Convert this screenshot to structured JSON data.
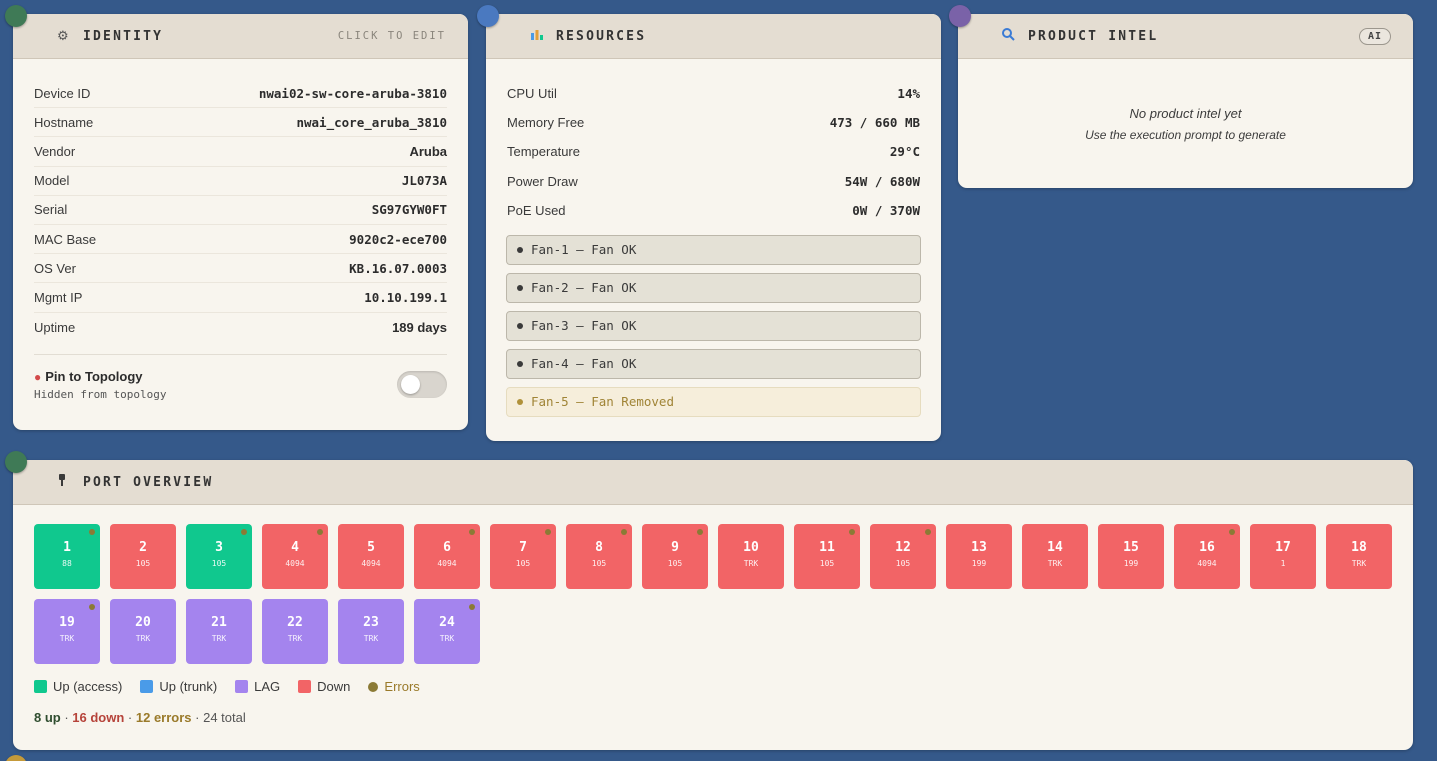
{
  "colors": {
    "background": "#35598a",
    "card": "#f8f5ee",
    "header": "#e4ddd2",
    "port_up": "#10c88e",
    "port_trunk": "#4a9be8",
    "port_lag": "#a484ee",
    "port_down": "#f26466",
    "error": "#8b7a35"
  },
  "identity": {
    "icon": "network-icon",
    "title": "IDENTITY",
    "edit_label": "CLICK TO EDIT",
    "rows": [
      {
        "label": "Device ID",
        "value": "nwai02-sw-core-aruba-3810"
      },
      {
        "label": "Hostname",
        "value": "nwai_core_aruba_3810"
      },
      {
        "label": "Vendor",
        "value": "Aruba"
      },
      {
        "label": "Model",
        "value": "JL073A"
      },
      {
        "label": "Serial",
        "value": "SG97GYW0FT"
      },
      {
        "label": "MAC Base",
        "value": "9020c2-ece700"
      },
      {
        "label": "OS Ver",
        "value": "KB.16.07.0003"
      },
      {
        "label": "Mgmt IP",
        "value": "10.10.199.1"
      },
      {
        "label": "Uptime",
        "value": "189 days"
      }
    ],
    "pin_title": "Pin to Topology",
    "pin_subtitle": "Hidden from topology",
    "pin_toggle_on": false
  },
  "resources": {
    "icon": "bar-chart-icon",
    "title": "RESOURCES",
    "rows": [
      {
        "label": "CPU Util",
        "value": "14%"
      },
      {
        "label": "Memory Free",
        "value": "473 / 660 MB"
      },
      {
        "label": "Temperature",
        "value": "29°C"
      },
      {
        "label": "Power Draw",
        "value": "54W / 680W"
      },
      {
        "label": "PoE Used",
        "value": "0W / 370W"
      }
    ],
    "fans": [
      {
        "label": "Fan-1 — Fan OK",
        "status": "ok"
      },
      {
        "label": "Fan-2 — Fan OK",
        "status": "ok"
      },
      {
        "label": "Fan-3 — Fan OK",
        "status": "ok"
      },
      {
        "label": "Fan-4 — Fan OK",
        "status": "ok"
      },
      {
        "label": "Fan-5 — Fan Removed",
        "status": "removed"
      }
    ]
  },
  "product_intel": {
    "icon": "magnifier-icon",
    "title": "PRODUCT INTEL",
    "badge": "AI",
    "empty_title": "No product intel yet",
    "empty_subtitle": "Use the execution prompt to generate"
  },
  "ports_panel": {
    "icon": "plug-icon",
    "title": "PORT OVERVIEW",
    "ports": [
      {
        "num": "1",
        "vlan": "88",
        "state": "up",
        "error": true
      },
      {
        "num": "2",
        "vlan": "105",
        "state": "down",
        "error": false
      },
      {
        "num": "3",
        "vlan": "105",
        "state": "up",
        "error": true
      },
      {
        "num": "4",
        "vlan": "4094",
        "state": "down",
        "error": true
      },
      {
        "num": "5",
        "vlan": "4094",
        "state": "down",
        "error": false
      },
      {
        "num": "6",
        "vlan": "4094",
        "state": "down",
        "error": true
      },
      {
        "num": "7",
        "vlan": "105",
        "state": "down",
        "error": true
      },
      {
        "num": "8",
        "vlan": "105",
        "state": "down",
        "error": true
      },
      {
        "num": "9",
        "vlan": "105",
        "state": "down",
        "error": true
      },
      {
        "num": "10",
        "vlan": "TRK",
        "state": "down",
        "error": false
      },
      {
        "num": "11",
        "vlan": "105",
        "state": "down",
        "error": true
      },
      {
        "num": "12",
        "vlan": "105",
        "state": "down",
        "error": true
      },
      {
        "num": "13",
        "vlan": "199",
        "state": "down",
        "error": false
      },
      {
        "num": "14",
        "vlan": "TRK",
        "state": "down",
        "error": false
      },
      {
        "num": "15",
        "vlan": "199",
        "state": "down",
        "error": false
      },
      {
        "num": "16",
        "vlan": "4094",
        "state": "down",
        "error": true
      },
      {
        "num": "17",
        "vlan": "1",
        "state": "down",
        "error": false
      },
      {
        "num": "18",
        "vlan": "TRK",
        "state": "down",
        "error": false
      },
      {
        "num": "19",
        "vlan": "TRK",
        "state": "lag",
        "error": true
      },
      {
        "num": "20",
        "vlan": "TRK",
        "state": "lag",
        "error": false
      },
      {
        "num": "21",
        "vlan": "TRK",
        "state": "lag",
        "error": false
      },
      {
        "num": "22",
        "vlan": "TRK",
        "state": "lag",
        "error": false
      },
      {
        "num": "23",
        "vlan": "TRK",
        "state": "lag",
        "error": false
      },
      {
        "num": "24",
        "vlan": "TRK",
        "state": "lag",
        "error": true
      }
    ],
    "legend": [
      {
        "label": "Up (access)",
        "color": "#10c88e",
        "shape": "square"
      },
      {
        "label": "Up (trunk)",
        "color": "#4a9be8",
        "shape": "square"
      },
      {
        "label": "LAG",
        "color": "#a484ee",
        "shape": "square"
      },
      {
        "label": "Down",
        "color": "#f26466",
        "shape": "square"
      },
      {
        "label": "Errors",
        "color": "#8b7a35",
        "shape": "dot"
      }
    ],
    "summary": {
      "up": "8 up",
      "down": "16 down",
      "errors": "12 errors",
      "total": "24 total",
      "separator": " · "
    }
  }
}
